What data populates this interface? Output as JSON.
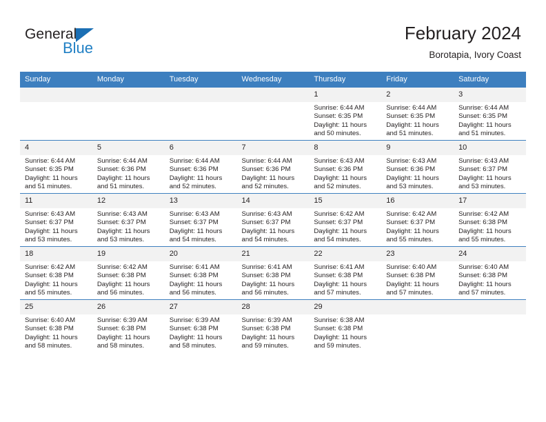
{
  "brand": {
    "name_part1": "General",
    "name_part2": "Blue",
    "accent_color": "#1b6fb4"
  },
  "header": {
    "title": "February 2024",
    "subtitle": "Borotapia, Ivory Coast"
  },
  "calendar": {
    "header_bg": "#3d7fbf",
    "daynum_bg": "#f2f2f2",
    "weekdays": [
      "Sunday",
      "Monday",
      "Tuesday",
      "Wednesday",
      "Thursday",
      "Friday",
      "Saturday"
    ],
    "weeks": [
      [
        {
          "day": "",
          "blank": true,
          "sunrise": "",
          "sunset": "",
          "daylight1": "",
          "daylight2": ""
        },
        {
          "day": "",
          "blank": true,
          "sunrise": "",
          "sunset": "",
          "daylight1": "",
          "daylight2": ""
        },
        {
          "day": "",
          "blank": true,
          "sunrise": "",
          "sunset": "",
          "daylight1": "",
          "daylight2": ""
        },
        {
          "day": "",
          "blank": true,
          "sunrise": "",
          "sunset": "",
          "daylight1": "",
          "daylight2": ""
        },
        {
          "day": "1",
          "sunrise": "Sunrise: 6:44 AM",
          "sunset": "Sunset: 6:35 PM",
          "daylight1": "Daylight: 11 hours",
          "daylight2": "and 50 minutes."
        },
        {
          "day": "2",
          "sunrise": "Sunrise: 6:44 AM",
          "sunset": "Sunset: 6:35 PM",
          "daylight1": "Daylight: 11 hours",
          "daylight2": "and 51 minutes."
        },
        {
          "day": "3",
          "sunrise": "Sunrise: 6:44 AM",
          "sunset": "Sunset: 6:35 PM",
          "daylight1": "Daylight: 11 hours",
          "daylight2": "and 51 minutes."
        }
      ],
      [
        {
          "day": "4",
          "sunrise": "Sunrise: 6:44 AM",
          "sunset": "Sunset: 6:35 PM",
          "daylight1": "Daylight: 11 hours",
          "daylight2": "and 51 minutes."
        },
        {
          "day": "5",
          "sunrise": "Sunrise: 6:44 AM",
          "sunset": "Sunset: 6:36 PM",
          "daylight1": "Daylight: 11 hours",
          "daylight2": "and 51 minutes."
        },
        {
          "day": "6",
          "sunrise": "Sunrise: 6:44 AM",
          "sunset": "Sunset: 6:36 PM",
          "daylight1": "Daylight: 11 hours",
          "daylight2": "and 52 minutes."
        },
        {
          "day": "7",
          "sunrise": "Sunrise: 6:44 AM",
          "sunset": "Sunset: 6:36 PM",
          "daylight1": "Daylight: 11 hours",
          "daylight2": "and 52 minutes."
        },
        {
          "day": "8",
          "sunrise": "Sunrise: 6:43 AM",
          "sunset": "Sunset: 6:36 PM",
          "daylight1": "Daylight: 11 hours",
          "daylight2": "and 52 minutes."
        },
        {
          "day": "9",
          "sunrise": "Sunrise: 6:43 AM",
          "sunset": "Sunset: 6:36 PM",
          "daylight1": "Daylight: 11 hours",
          "daylight2": "and 53 minutes."
        },
        {
          "day": "10",
          "sunrise": "Sunrise: 6:43 AM",
          "sunset": "Sunset: 6:37 PM",
          "daylight1": "Daylight: 11 hours",
          "daylight2": "and 53 minutes."
        }
      ],
      [
        {
          "day": "11",
          "sunrise": "Sunrise: 6:43 AM",
          "sunset": "Sunset: 6:37 PM",
          "daylight1": "Daylight: 11 hours",
          "daylight2": "and 53 minutes."
        },
        {
          "day": "12",
          "sunrise": "Sunrise: 6:43 AM",
          "sunset": "Sunset: 6:37 PM",
          "daylight1": "Daylight: 11 hours",
          "daylight2": "and 53 minutes."
        },
        {
          "day": "13",
          "sunrise": "Sunrise: 6:43 AM",
          "sunset": "Sunset: 6:37 PM",
          "daylight1": "Daylight: 11 hours",
          "daylight2": "and 54 minutes."
        },
        {
          "day": "14",
          "sunrise": "Sunrise: 6:43 AM",
          "sunset": "Sunset: 6:37 PM",
          "daylight1": "Daylight: 11 hours",
          "daylight2": "and 54 minutes."
        },
        {
          "day": "15",
          "sunrise": "Sunrise: 6:42 AM",
          "sunset": "Sunset: 6:37 PM",
          "daylight1": "Daylight: 11 hours",
          "daylight2": "and 54 minutes."
        },
        {
          "day": "16",
          "sunrise": "Sunrise: 6:42 AM",
          "sunset": "Sunset: 6:37 PM",
          "daylight1": "Daylight: 11 hours",
          "daylight2": "and 55 minutes."
        },
        {
          "day": "17",
          "sunrise": "Sunrise: 6:42 AM",
          "sunset": "Sunset: 6:38 PM",
          "daylight1": "Daylight: 11 hours",
          "daylight2": "and 55 minutes."
        }
      ],
      [
        {
          "day": "18",
          "sunrise": "Sunrise: 6:42 AM",
          "sunset": "Sunset: 6:38 PM",
          "daylight1": "Daylight: 11 hours",
          "daylight2": "and 55 minutes."
        },
        {
          "day": "19",
          "sunrise": "Sunrise: 6:42 AM",
          "sunset": "Sunset: 6:38 PM",
          "daylight1": "Daylight: 11 hours",
          "daylight2": "and 56 minutes."
        },
        {
          "day": "20",
          "sunrise": "Sunrise: 6:41 AM",
          "sunset": "Sunset: 6:38 PM",
          "daylight1": "Daylight: 11 hours",
          "daylight2": "and 56 minutes."
        },
        {
          "day": "21",
          "sunrise": "Sunrise: 6:41 AM",
          "sunset": "Sunset: 6:38 PM",
          "daylight1": "Daylight: 11 hours",
          "daylight2": "and 56 minutes."
        },
        {
          "day": "22",
          "sunrise": "Sunrise: 6:41 AM",
          "sunset": "Sunset: 6:38 PM",
          "daylight1": "Daylight: 11 hours",
          "daylight2": "and 57 minutes."
        },
        {
          "day": "23",
          "sunrise": "Sunrise: 6:40 AM",
          "sunset": "Sunset: 6:38 PM",
          "daylight1": "Daylight: 11 hours",
          "daylight2": "and 57 minutes."
        },
        {
          "day": "24",
          "sunrise": "Sunrise: 6:40 AM",
          "sunset": "Sunset: 6:38 PM",
          "daylight1": "Daylight: 11 hours",
          "daylight2": "and 57 minutes."
        }
      ],
      [
        {
          "day": "25",
          "sunrise": "Sunrise: 6:40 AM",
          "sunset": "Sunset: 6:38 PM",
          "daylight1": "Daylight: 11 hours",
          "daylight2": "and 58 minutes."
        },
        {
          "day": "26",
          "sunrise": "Sunrise: 6:39 AM",
          "sunset": "Sunset: 6:38 PM",
          "daylight1": "Daylight: 11 hours",
          "daylight2": "and 58 minutes."
        },
        {
          "day": "27",
          "sunrise": "Sunrise: 6:39 AM",
          "sunset": "Sunset: 6:38 PM",
          "daylight1": "Daylight: 11 hours",
          "daylight2": "and 58 minutes."
        },
        {
          "day": "28",
          "sunrise": "Sunrise: 6:39 AM",
          "sunset": "Sunset: 6:38 PM",
          "daylight1": "Daylight: 11 hours",
          "daylight2": "and 59 minutes."
        },
        {
          "day": "29",
          "sunrise": "Sunrise: 6:38 AM",
          "sunset": "Sunset: 6:38 PM",
          "daylight1": "Daylight: 11 hours",
          "daylight2": "and 59 minutes."
        },
        {
          "day": "",
          "blank": true,
          "sunrise": "",
          "sunset": "",
          "daylight1": "",
          "daylight2": ""
        },
        {
          "day": "",
          "blank": true,
          "sunrise": "",
          "sunset": "",
          "daylight1": "",
          "daylight2": ""
        }
      ]
    ]
  }
}
